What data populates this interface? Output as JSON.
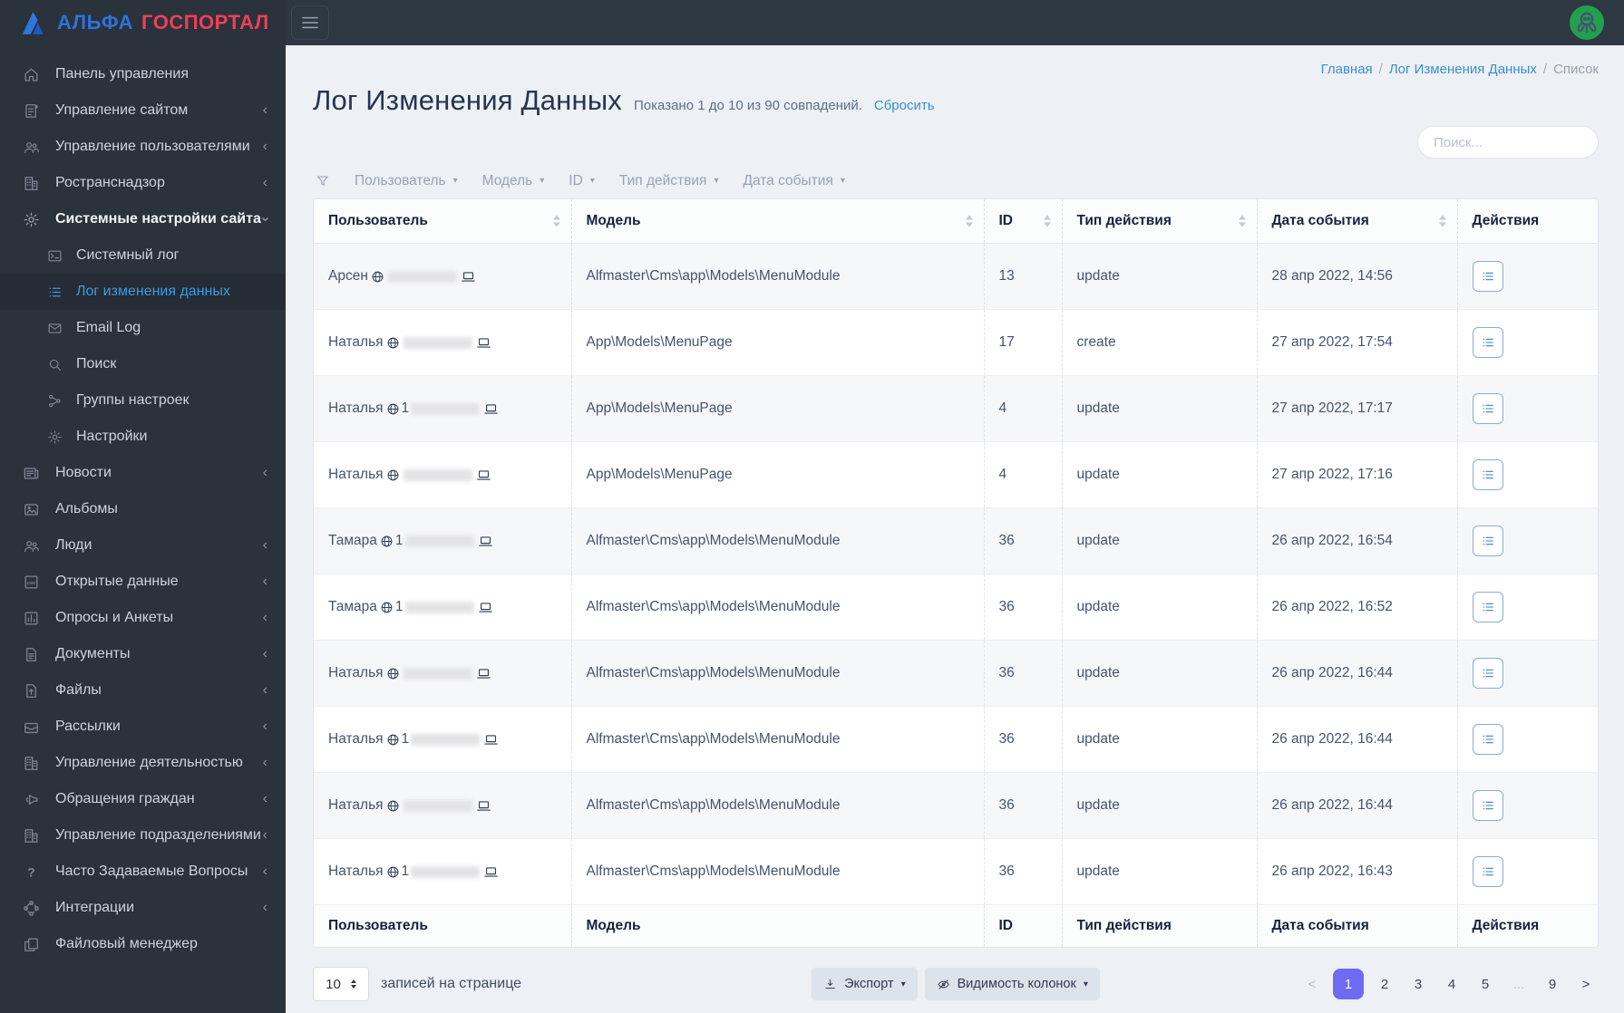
{
  "brand": {
    "alpha": "АЛЬФА",
    "gosportal": "ГОСПОРТАЛ",
    "alpha_color": "#2e72da",
    "gosportal_color": "#ee4058"
  },
  "topbar": {
    "burger_icon": "hamburger-icon",
    "avatar_icon": "octopus-avatar",
    "avatar_bg": "#22a04d"
  },
  "sidebar": {
    "items": [
      {
        "label": "Панель управления",
        "icon": "home-icon",
        "chevron": "none"
      },
      {
        "label": "Управление сайтом",
        "icon": "page-plus-icon",
        "chevron": "left"
      },
      {
        "label": "Управление пользователями",
        "icon": "users-icon",
        "chevron": "left"
      },
      {
        "label": "Ространснадзор",
        "icon": "building-icon",
        "chevron": "left"
      },
      {
        "label": "Системные настройки сайта",
        "icon": "gear-icon",
        "chevron": "down",
        "expanded": true,
        "children": [
          {
            "label": "Системный лог",
            "icon": "terminal-icon"
          },
          {
            "label": "Лог изменения данных",
            "icon": "list-icon",
            "active": true
          },
          {
            "label": "Email Log",
            "icon": "envelope-icon"
          },
          {
            "label": "Поиск",
            "icon": "search-icon"
          },
          {
            "label": "Группы настроек",
            "icon": "nodes-icon"
          },
          {
            "label": "Настройки",
            "icon": "gear-icon"
          }
        ]
      },
      {
        "label": "Новости",
        "icon": "newspaper-icon",
        "chevron": "left"
      },
      {
        "label": "Альбомы",
        "icon": "image-icon",
        "chevron": "none"
      },
      {
        "label": "Люди",
        "icon": "users-icon",
        "chevron": "left"
      },
      {
        "label": "Открытые данные",
        "icon": "csv-icon",
        "chevron": "left"
      },
      {
        "label": "Опросы и Анкеты",
        "icon": "chart-icon",
        "chevron": "left"
      },
      {
        "label": "Документы",
        "icon": "document-icon",
        "chevron": "left"
      },
      {
        "label": "Файлы",
        "icon": "file-upload-icon",
        "chevron": "left"
      },
      {
        "label": "Рассылки",
        "icon": "mail-tray-icon",
        "chevron": "left"
      },
      {
        "label": "Управление деятельностью",
        "icon": "building-icon",
        "chevron": "left"
      },
      {
        "label": "Обращения граждан",
        "icon": "megaphone-icon",
        "chevron": "left"
      },
      {
        "label": "Управление подразделениями",
        "icon": "building-icon",
        "chevron": "left"
      },
      {
        "label": "Часто Задаваемые Вопросы",
        "icon": "question-icon",
        "chevron": "left"
      },
      {
        "label": "Интеграции",
        "icon": "integration-icon",
        "chevron": "left"
      },
      {
        "label": "Файловый менеджер",
        "icon": "copy-icon",
        "chevron": "none"
      }
    ]
  },
  "breadcrumb": {
    "items": [
      "Главная",
      "Лог Изменения Данных",
      "Список"
    ]
  },
  "page": {
    "title": "Лог Изменения Данных",
    "subtitle": "Показано 1 до 10 из 90 совпадений.",
    "reset_link": "Сбросить"
  },
  "search": {
    "placeholder": "Поиск..."
  },
  "filters": {
    "funnel_icon": "funnel-icon",
    "items": [
      "Пользователь",
      "Модель",
      "ID",
      "Тип действия",
      "Дата события"
    ]
  },
  "table": {
    "columns": [
      "Пользователь",
      "Модель",
      "ID",
      "Тип действия",
      "Дата события",
      "Действия"
    ],
    "row_action_icon": "list-details-icon",
    "user_icons": [
      "globe-icon",
      "laptop-icon"
    ],
    "rows": [
      {
        "user": "Арсен",
        "ip_prefix": "",
        "ip_redacted": true,
        "model": "Alfmaster\\Cms\\app\\Models\\MenuModule",
        "id": "13",
        "action": "update",
        "date": "28 апр 2022, 14:56"
      },
      {
        "user": "Наталья",
        "ip_prefix": "",
        "ip_redacted": true,
        "model": "App\\Models\\MenuPage",
        "id": "17",
        "action": "create",
        "date": "27 апр 2022, 17:54"
      },
      {
        "user": "Наталья",
        "ip_prefix": "1",
        "ip_redacted": true,
        "model": "App\\Models\\MenuPage",
        "id": "4",
        "action": "update",
        "date": "27 апр 2022, 17:17"
      },
      {
        "user": "Наталья",
        "ip_prefix": "",
        "ip_redacted": true,
        "model": "App\\Models\\MenuPage",
        "id": "4",
        "action": "update",
        "date": "27 апр 2022, 17:16"
      },
      {
        "user": "Тамара",
        "ip_prefix": "1",
        "ip_redacted": true,
        "model": "Alfmaster\\Cms\\app\\Models\\MenuModule",
        "id": "36",
        "action": "update",
        "date": "26 апр 2022, 16:54"
      },
      {
        "user": "Тамара",
        "ip_prefix": "1",
        "ip_redacted": true,
        "model": "Alfmaster\\Cms\\app\\Models\\MenuModule",
        "id": "36",
        "action": "update",
        "date": "26 апр 2022, 16:52"
      },
      {
        "user": "Наталья",
        "ip_prefix": "",
        "ip_redacted": true,
        "model": "Alfmaster\\Cms\\app\\Models\\MenuModule",
        "id": "36",
        "action": "update",
        "date": "26 апр 2022, 16:44"
      },
      {
        "user": "Наталья",
        "ip_prefix": "1",
        "ip_redacted": true,
        "model": "Alfmaster\\Cms\\app\\Models\\MenuModule",
        "id": "36",
        "action": "update",
        "date": "26 апр 2022, 16:44"
      },
      {
        "user": "Наталья",
        "ip_prefix": "",
        "ip_redacted": true,
        "model": "Alfmaster\\Cms\\app\\Models\\MenuModule",
        "id": "36",
        "action": "update",
        "date": "26 апр 2022, 16:44"
      },
      {
        "user": "Наталья",
        "ip_prefix": "1",
        "ip_redacted": true,
        "model": "Alfmaster\\Cms\\app\\Models\\MenuModule",
        "id": "36",
        "action": "update",
        "date": "26 апр 2022, 16:43"
      }
    ]
  },
  "footer": {
    "page_size": "10",
    "page_size_label": "записей на странице",
    "export_label": "Экспорт",
    "export_icon": "download-icon",
    "columns_label": "Видимость колонок",
    "columns_icon": "eye-slash-icon",
    "pagination": [
      {
        "label": "<",
        "muted": true
      },
      {
        "label": "1",
        "active": true
      },
      {
        "label": "2"
      },
      {
        "label": "3"
      },
      {
        "label": "4"
      },
      {
        "label": "5"
      },
      {
        "label": "...",
        "muted": true
      },
      {
        "label": "9"
      },
      {
        "label": ">"
      }
    ],
    "active_page": "1",
    "active_page_color": "#6f6af2"
  }
}
